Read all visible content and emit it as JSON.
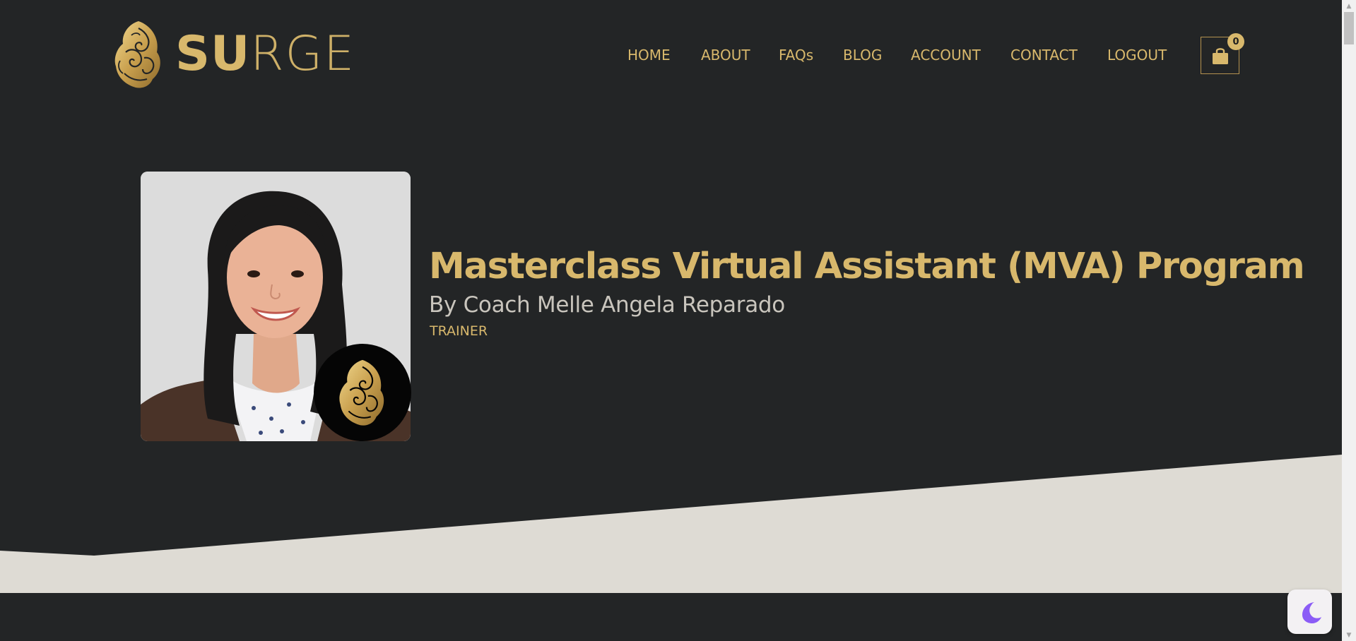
{
  "brand": {
    "logo_text_bold": "SU",
    "logo_text_light": "RGE"
  },
  "nav": {
    "items": [
      {
        "label": "HOME"
      },
      {
        "label": "ABOUT"
      },
      {
        "label": "FAQs"
      },
      {
        "label": "BLOG"
      },
      {
        "label": "ACCOUNT"
      },
      {
        "label": "CONTACT"
      },
      {
        "label": "LOGOUT"
      }
    ],
    "cart_count": "0",
    "cart_icon": "shopping-bag-icon"
  },
  "hero": {
    "title": "Masterclass Virtual Assistant (MVA) Program",
    "subtitle": "By Coach Melle Angela Reparado",
    "role": "TRAINER"
  },
  "colors": {
    "background": "#232526",
    "gold": "#d8b86c",
    "light_band": "#dedbd4",
    "subtitle_text": "#c9c5bd",
    "moon": "#8b5cf6"
  },
  "widgets": {
    "darkmode_icon": "moon-icon"
  }
}
